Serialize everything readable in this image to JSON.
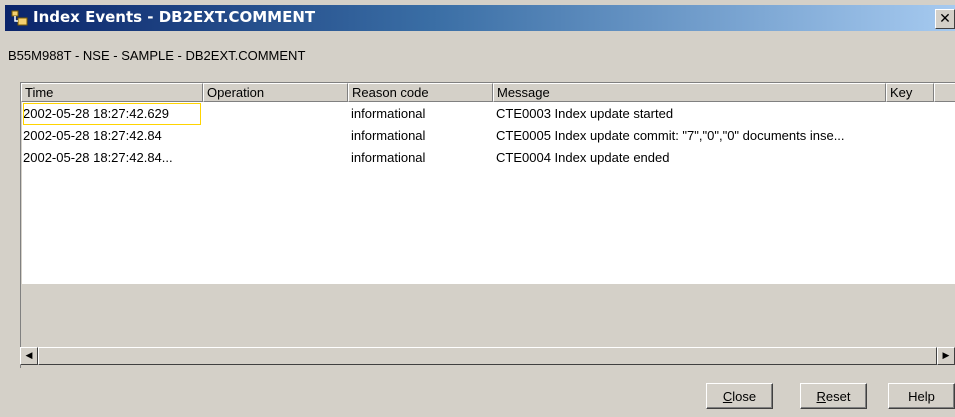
{
  "window": {
    "title": "Index Events - DB2EXT.COMMENT",
    "close_glyph": "✕"
  },
  "breadcrumb": "B55M988T - NSE - SAMPLE - DB2EXT.COMMENT",
  "table": {
    "columns": [
      "Time",
      "Operation",
      "Reason code",
      "Message",
      "Key"
    ],
    "rows": [
      {
        "time": "2002-05-28 18:27:42.629",
        "operation": "",
        "reason": "informational",
        "message": "CTE0003 Index update started",
        "key": ""
      },
      {
        "time": "2002-05-28 18:27:42.84",
        "operation": "",
        "reason": "informational",
        "message": "CTE0005 Index update commit: \"7\",\"0\",\"0\" documents inse...",
        "key": ""
      },
      {
        "time": "2002-05-28 18:27:42.84...",
        "operation": "",
        "reason": "informational",
        "message": "CTE0004 Index update ended",
        "key": ""
      }
    ]
  },
  "scrollbar": {
    "left_arrow": "◀",
    "right_arrow": "▶"
  },
  "buttons": {
    "close": {
      "mnemonic": "C",
      "rest": "lose"
    },
    "reset": {
      "mnemonic": "R",
      "rest": "eset"
    },
    "help": "Help"
  },
  "icons": {
    "title_icon": "db-index-icon"
  }
}
